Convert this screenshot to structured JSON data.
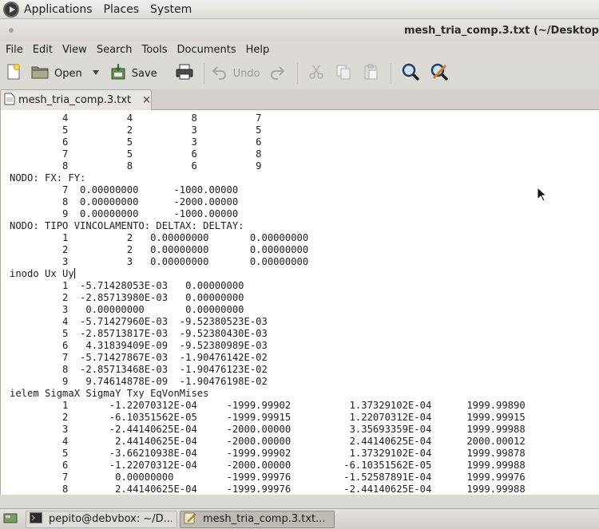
{
  "top_panel": {
    "menus": [
      "Applications",
      "Places",
      "System"
    ]
  },
  "window": {
    "title": "mesh_tria_comp.3.txt (~/Desktop"
  },
  "menubar": {
    "items": [
      "File",
      "Edit",
      "View",
      "Search",
      "Tools",
      "Documents",
      "Help"
    ]
  },
  "toolbar": {
    "open_label": "Open",
    "save_label": "Save",
    "undo_label": "Undo"
  },
  "tab": {
    "label": "mesh_tria_comp.3.txt",
    "close": "×"
  },
  "editor": {
    "lines_before_caret": "         4          4          8          7\n         5          2          3          5\n         6          5          3          6\n         7          5          6          8\n         8          8          6          9\nNODO: FX: FY:\n         7  0.00000000      -1000.00000\n         8  0.00000000      -2000.00000\n         9  0.00000000      -1000.00000\nNODO: TIPO VINCOLAMENTO: DELTAX: DELTAY:\n         1          2   0.00000000       0.00000000\n         2          2   0.00000000       0.00000000\n         3          3   0.00000000       0.00000000\ninodo Ux Uy",
    "lines_after_caret": "\n         1  -5.71428053E-03   0.00000000\n         2  -2.85713980E-03   0.00000000\n         3   0.00000000       0.00000000\n         4  -5.71427960E-03  -9.52380523E-03\n         5  -2.85713817E-03  -9.52380430E-03\n         6   4.31839409E-09  -9.52380989E-03\n         7  -5.71427867E-03  -1.90476142E-02\n         8  -2.85713468E-03  -1.90476123E-02\n         9   9.74614878E-09  -1.90476198E-02\nielem SigmaX SigmaY Txy EqVonMises\n         1       -1.22070312E-04     -1999.99902          1.37329102E-04      1999.99890\n         2       -6.10351562E-05     -1999.99915          1.22070312E-04      1999.99915\n         3       -2.44140625E-04     -2000.00000          3.35693359E-04      1999.99988\n         4        2.44140625E-04     -2000.00000          2.44140625E-04      2000.00012\n         5       -3.66210938E-04     -1999.99902          1.37329102E-04      1999.99878\n         6       -1.22070312E-04     -2000.00000         -6.10351562E-05      1999.99988\n         7        0.00000000         -1999.99976         -1.52587891E-04      1999.99976\n         8        2.44140625E-04     -1999.99976         -2.44140625E-04      1999.99988"
  },
  "taskbar": {
    "tasks": [
      {
        "label": "pepito@debvbox: ~/D..."
      },
      {
        "label": "mesh_tria_comp.3.txt..."
      }
    ]
  },
  "colors": {
    "panel_bg": "#dcdad5",
    "editor_bg": "#ffffff",
    "text": "#202020"
  }
}
